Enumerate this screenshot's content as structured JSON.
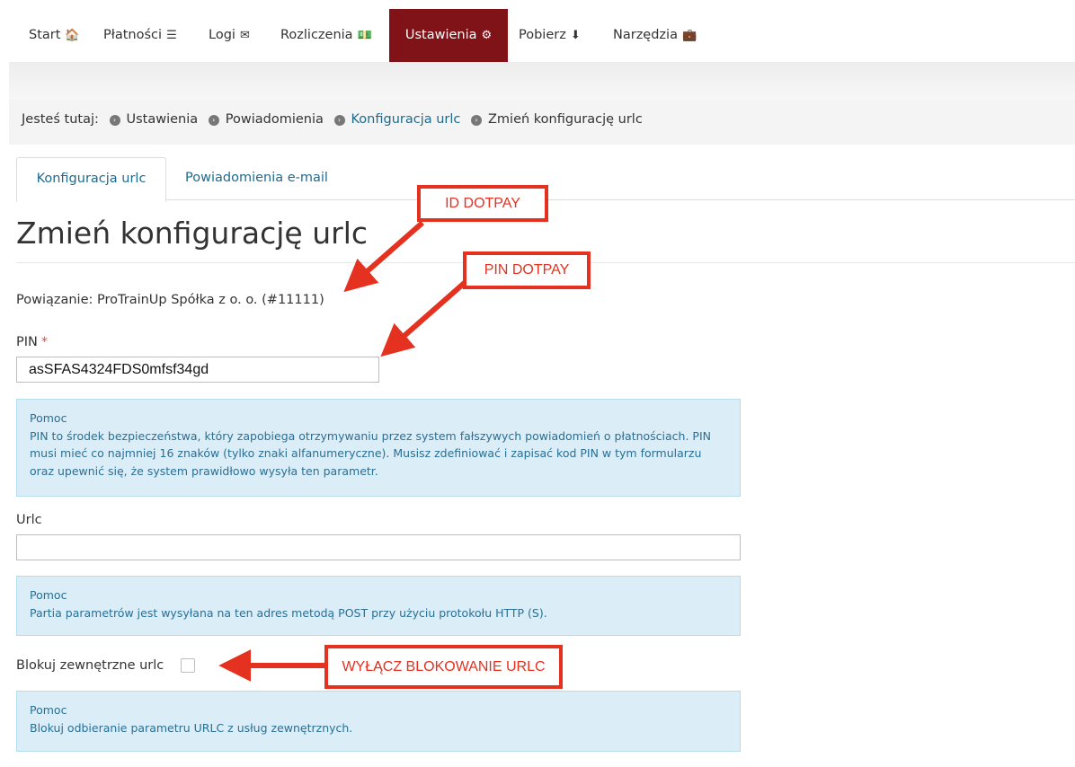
{
  "nav": [
    {
      "label": "Start",
      "icon": "home-icon",
      "glyph": "🏠"
    },
    {
      "label": "Płatności",
      "icon": "list-icon",
      "glyph": "☰"
    },
    {
      "label": "Logi",
      "icon": "envelope-icon",
      "glyph": "✉"
    },
    {
      "label": "Rozliczenia",
      "icon": "money-icon",
      "glyph": "💵"
    },
    {
      "label": "Ustawienia",
      "icon": "cogs-icon",
      "glyph": "⚙",
      "active": true
    },
    {
      "label": "Pobierz",
      "icon": "download-icon",
      "glyph": "⬇"
    },
    {
      "label": "Narzędzia",
      "icon": "briefcase-icon",
      "glyph": "💼"
    }
  ],
  "breadcrumb": {
    "prefix": "Jesteś tutaj:",
    "items": [
      "Ustawienia",
      "Powiadomienia",
      "Konfiguracja urlc",
      "Zmień konfigurację urlc"
    ]
  },
  "tabs": [
    "Konfiguracja urlc",
    "Powiadomienia e-mail"
  ],
  "page_title": "Zmień konfigurację urlc",
  "association": "Powiązanie: ProTrainUp Spółka z o. o. (#11111)",
  "pin": {
    "label": "PIN",
    "required_mark": "*",
    "value": "asSFAS4324FDS0mfsf34gd",
    "help_title": "Pomoc",
    "help_text": "PIN to środek bezpieczeństwa, który zapobiega otrzymywaniu przez system fałszywych powiadomień o płatnościach. PIN musi mieć co najmniej 16 znaków (tylko znaki alfanumeryczne). Musisz zdefiniować i zapisać kod PIN w tym formularzu oraz upewnić się, że system prawidłowo wysyła ten parametr."
  },
  "urlc": {
    "label": "Urlc",
    "value": "",
    "help_title": "Pomoc",
    "help_text": "Partia parametrów jest wysyłana na ten adres metodą POST przy użyciu protokołu HTTP (S)."
  },
  "block": {
    "label": "Blokuj zewnętrzne urlc",
    "checked": false,
    "help_title": "Pomoc",
    "help_text": "Blokuj odbieranie parametru URLC z usług zewnętrznych."
  },
  "annotations": {
    "id_dotpay": "ID DOTPAY",
    "pin_dotpay": "PIN DOTPAY",
    "disable_block": "WYŁĄCZ BLOKOWANIE URLC",
    "color": "#e5311f"
  },
  "colors": {
    "active_nav": "#7f1318",
    "link": "#1f6a8c",
    "help_bg": "#dbeef8"
  }
}
